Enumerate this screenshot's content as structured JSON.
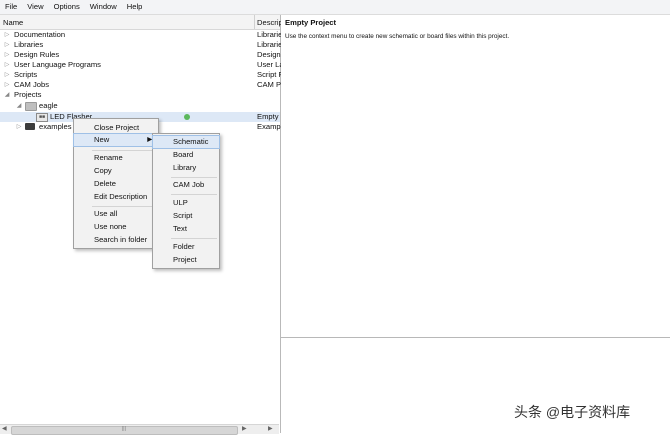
{
  "menubar": [
    "File",
    "View",
    "Options",
    "Window",
    "Help"
  ],
  "tree": {
    "header_name": "Name",
    "header_desc": "Descrip",
    "rows": [
      {
        "label": "Documentation",
        "desc": "Librarie"
      },
      {
        "label": "Libraries",
        "desc": "Librarie"
      },
      {
        "label": "Design Rules",
        "desc": "Design"
      },
      {
        "label": "User Language Programs",
        "desc": "User La"
      },
      {
        "label": "Scripts",
        "desc": "Script F"
      },
      {
        "label": "CAM Jobs",
        "desc": "CAM P"
      },
      {
        "label": "Projects",
        "desc": ""
      },
      {
        "label": "eagle",
        "desc": ""
      },
      {
        "label": "LED Flasher",
        "desc": "Empty"
      },
      {
        "label": "examples",
        "desc": "Exampl"
      }
    ]
  },
  "right_panel": {
    "title": "Empty Project",
    "text": "Use the context menu to create new schematic or board files within this project."
  },
  "context_menu": {
    "items": [
      "Close Project",
      "New",
      "Rename",
      "Copy",
      "Delete",
      "Edit Description",
      "Use all",
      "Use none",
      "Search in folder"
    ]
  },
  "new_submenu": {
    "items": [
      "Schematic",
      "Board",
      "Library",
      "CAM Job",
      "ULP",
      "Script",
      "Text",
      "Folder",
      "Project"
    ]
  },
  "watermark": "头条 @电子资料库"
}
